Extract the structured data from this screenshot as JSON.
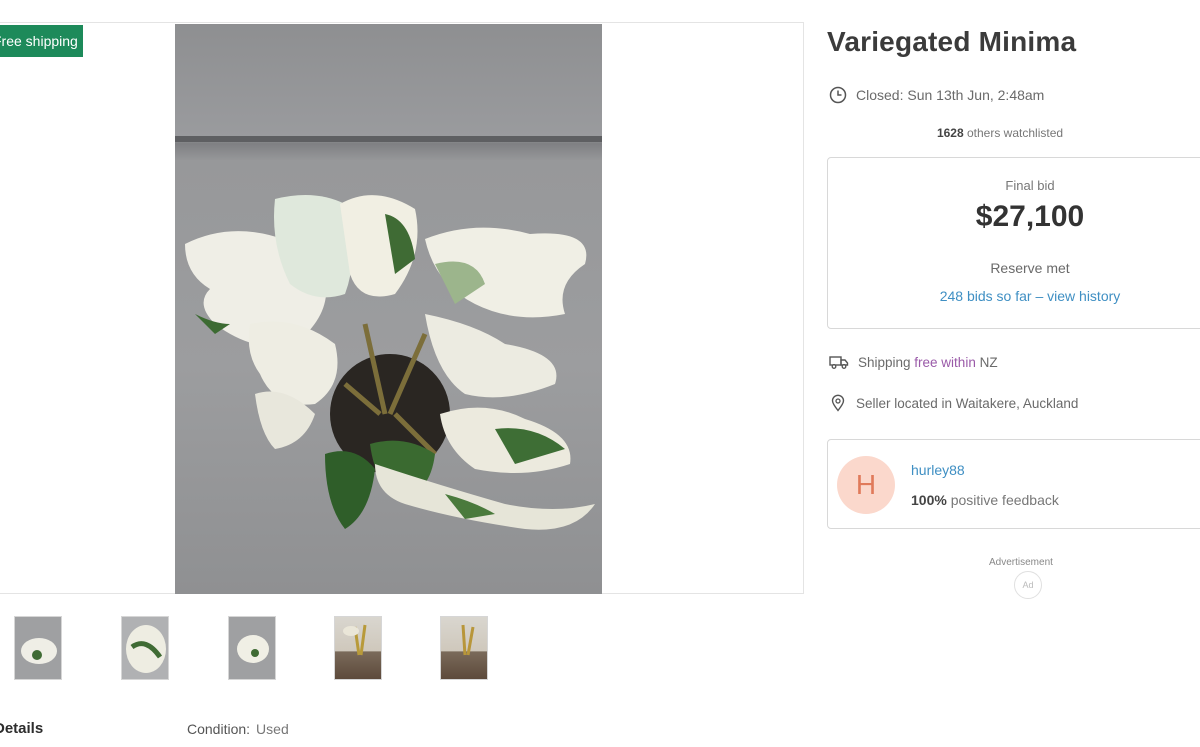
{
  "listing": {
    "badge": "Free shipping",
    "title": "Variegated Minima",
    "closed": "Closed: Sun 13th Jun, 2:48am",
    "watchlist_count": "1628",
    "watchlist_text": "others watchlisted"
  },
  "bid": {
    "label": "Final bid",
    "amount": "$27,100",
    "reserve": "Reserve met",
    "history": "248 bids so far – view history"
  },
  "shipping": {
    "prefix": "Shipping ",
    "free": "free within",
    "suffix": " NZ"
  },
  "location": "Seller located in Waitakere, Auckland",
  "seller": {
    "initial": "H",
    "name": "hurley88",
    "feedback_pct": "100%",
    "feedback_text": "positive feedback"
  },
  "ad": {
    "label": "Advertisement",
    "badge": "Ad"
  },
  "details": {
    "tab": "Details",
    "condition_label": "Condition:",
    "condition_value": "Used"
  },
  "colors": {
    "badge_green": "#1d8a5a",
    "link_blue": "#3f8fc3",
    "avatar_bg": "#fbd8cc"
  }
}
